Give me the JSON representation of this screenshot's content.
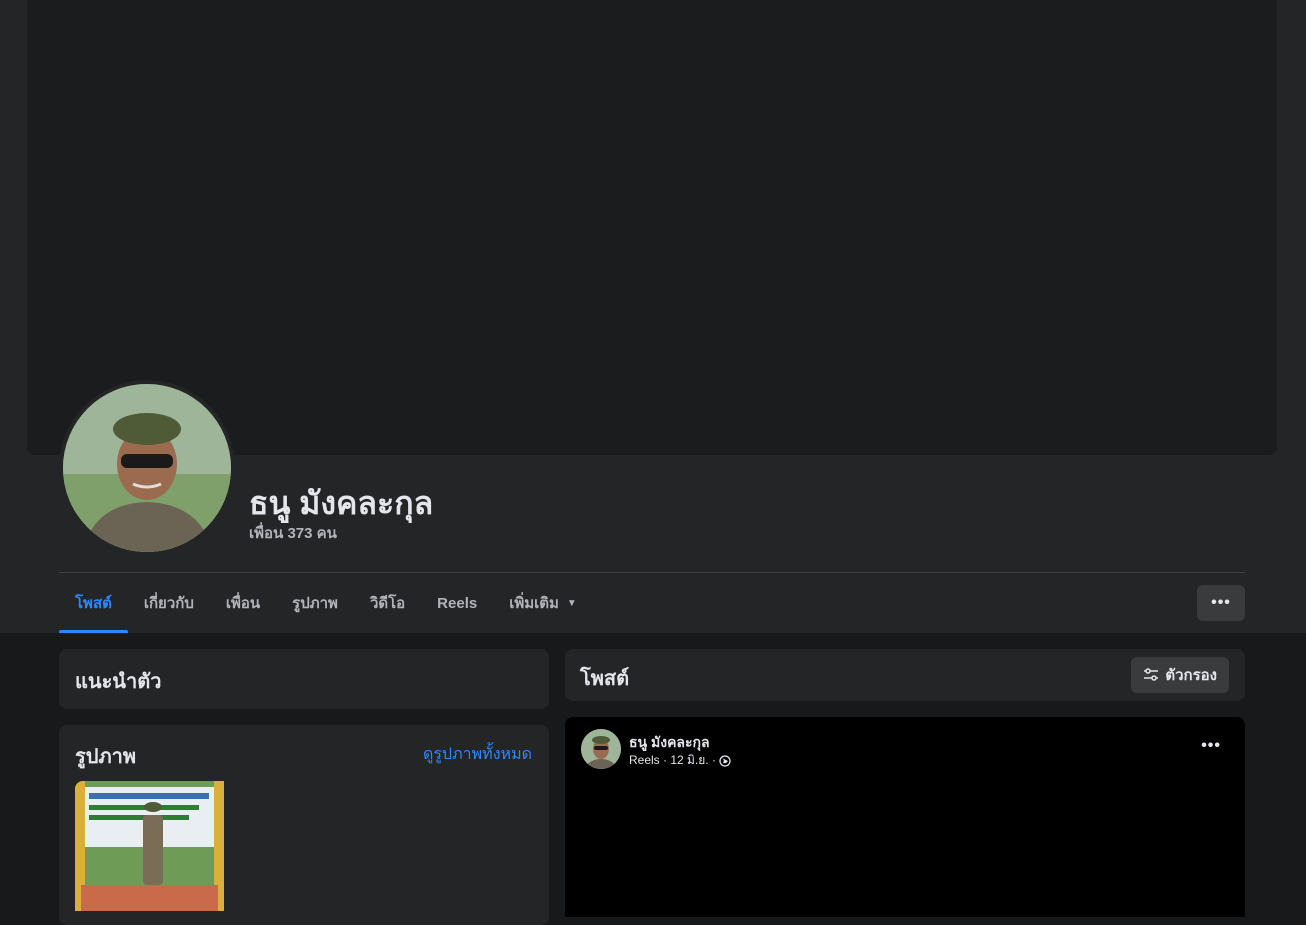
{
  "profile": {
    "name": "ธนู มังคละกุล",
    "friends": "เพื่อน 373 คน"
  },
  "tabs": [
    {
      "label": "โพสต์",
      "active": true
    },
    {
      "label": "เกี่ยวกับ"
    },
    {
      "label": "เพื่อน"
    },
    {
      "label": "รูปภาพ"
    },
    {
      "label": "วิดีโอ"
    },
    {
      "label": "Reels"
    },
    {
      "label": "เพิ่มเติม"
    }
  ],
  "more_button": "•••",
  "intro": {
    "title": "แนะนำตัว"
  },
  "photos": {
    "title": "รูปภาพ",
    "see_all": "ดูรูปภาพทั้งหมด"
  },
  "posts": {
    "title": "โพสต์",
    "filter_label": "ตัวกรอง"
  },
  "post": {
    "author": "ธนู มังคละกุล",
    "meta": "Reels · 12 มิ.ย. ·",
    "menu": "•••"
  },
  "colors": {
    "accent": "#2d88ff",
    "background": "#18191a",
    "surface": "#242526",
    "button": "#3a3b3c"
  },
  "icons": [
    "caret-down-icon",
    "filter-sliders-icon",
    "globe-icon",
    "more-dots-icon"
  ]
}
